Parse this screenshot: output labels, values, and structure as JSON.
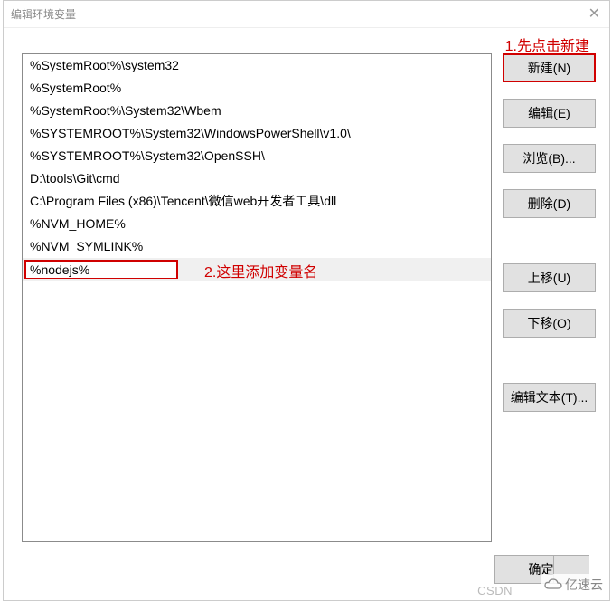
{
  "window": {
    "title": "编辑环境变量",
    "close_glyph": "✕"
  },
  "annotations": {
    "step1": "1.先点击新建",
    "step2": "2.这里添加变量名"
  },
  "path_list": {
    "items": [
      "%SystemRoot%\\system32",
      "%SystemRoot%",
      "%SystemRoot%\\System32\\Wbem",
      "%SYSTEMROOT%\\System32\\WindowsPowerShell\\v1.0\\",
      "%SYSTEMROOT%\\System32\\OpenSSH\\",
      "D:\\tools\\Git\\cmd",
      "C:\\Program Files (x86)\\Tencent\\微信web开发者工具\\dll",
      "%NVM_HOME%",
      "%NVM_SYMLINK%"
    ],
    "editing_value": "%nodejs%"
  },
  "buttons": {
    "new": "新建(N)",
    "edit": "编辑(E)",
    "browse": "浏览(B)...",
    "delete": "删除(D)",
    "move_up": "上移(U)",
    "move_down": "下移(O)",
    "edit_text": "编辑文本(T)...",
    "ok": "确定",
    "cancel": ""
  },
  "watermarks": {
    "csdn": "CSDN",
    "yisu": "亿速云"
  }
}
